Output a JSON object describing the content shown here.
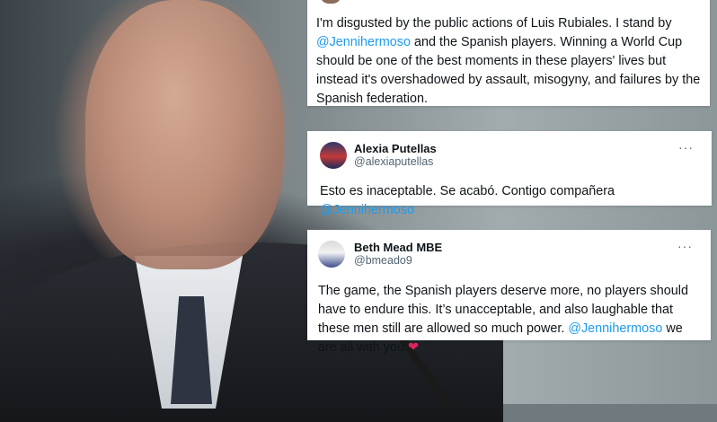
{
  "tweets": [
    {
      "text_before": "I'm disgusted by the public actions of Luis Rubiales. I stand by ",
      "mention": "@Jennihermoso",
      "text_after": "  and the Spanish players. Winning a World Cup should be one of the best moments in these players' lives but instead it's overshadowed by assault, misogyny, and failures by the Spanish federation."
    },
    {
      "name": "Alexia Putellas",
      "handle": "@alexiaputellas",
      "more_label": "···",
      "text_before": "Esto es inaceptable. Se acabó. Contigo compañera ",
      "mention": "@Jennihermoso"
    },
    {
      "name": "Beth Mead MBE",
      "handle": "@bmeado9",
      "more_label": "···",
      "text_before": "The game, the Spanish players deserve more, no players should have to endure this. It’s unacceptable, and also laughable that these men still are allowed so much power. ",
      "mention": "@Jennihermoso",
      "text_after": " we are all with you ",
      "emoji": "❤"
    }
  ],
  "colors": {
    "mention": "#1d9bf0",
    "heart": "#e0245e",
    "card_bg": "#ffffff"
  }
}
